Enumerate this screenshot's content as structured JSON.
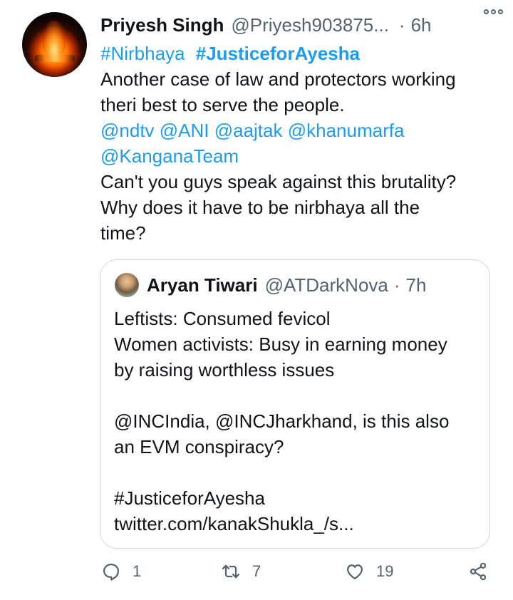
{
  "tweet": {
    "author_name": "Priyesh Singh",
    "author_handle": "@Priyesh903875...",
    "separator": "·",
    "time": "6h",
    "hashtag_1": "#Nirbhaya",
    "hashtag_2": "#JusticeforAyesha",
    "line_1": "Another case of law and protectors working",
    "line_2": "theri best to serve the people.",
    "mentions_1": "@ndtv @ANI @aajtak @khanumarfa",
    "mentions_2": "@KanganaTeam",
    "line_3": "Can't you guys speak against this brutality?",
    "line_4": "Why does it have to be nirbhaya all the",
    "line_5": "time?"
  },
  "quote": {
    "author_name": "Aryan Tiwari",
    "author_handle": "@ATDarkNova",
    "separator": "·",
    "time": "7h",
    "line_1": "Leftists: Consumed fevicol",
    "line_2": "Women activists: Busy in earning money",
    "line_3": "by raising worthless issues",
    "line_4": "@INCIndia, @INCJharkhand, is this also",
    "line_5": "an EVM conspiracy?",
    "line_6": "#JusticeforAyesha",
    "line_7": "twitter.com/kanakShukla_/s..."
  },
  "actions": {
    "reply_count": "1",
    "retweet_count": "7",
    "like_count": "19"
  },
  "icons": {
    "reply": "reply-icon",
    "retweet": "retweet-icon",
    "like": "heart-icon",
    "share": "share-icon",
    "more": "more-icon"
  },
  "colors": {
    "link": "#1d9bf0",
    "text": "#0f1419",
    "secondary": "#536471",
    "border": "#cfd9de"
  }
}
